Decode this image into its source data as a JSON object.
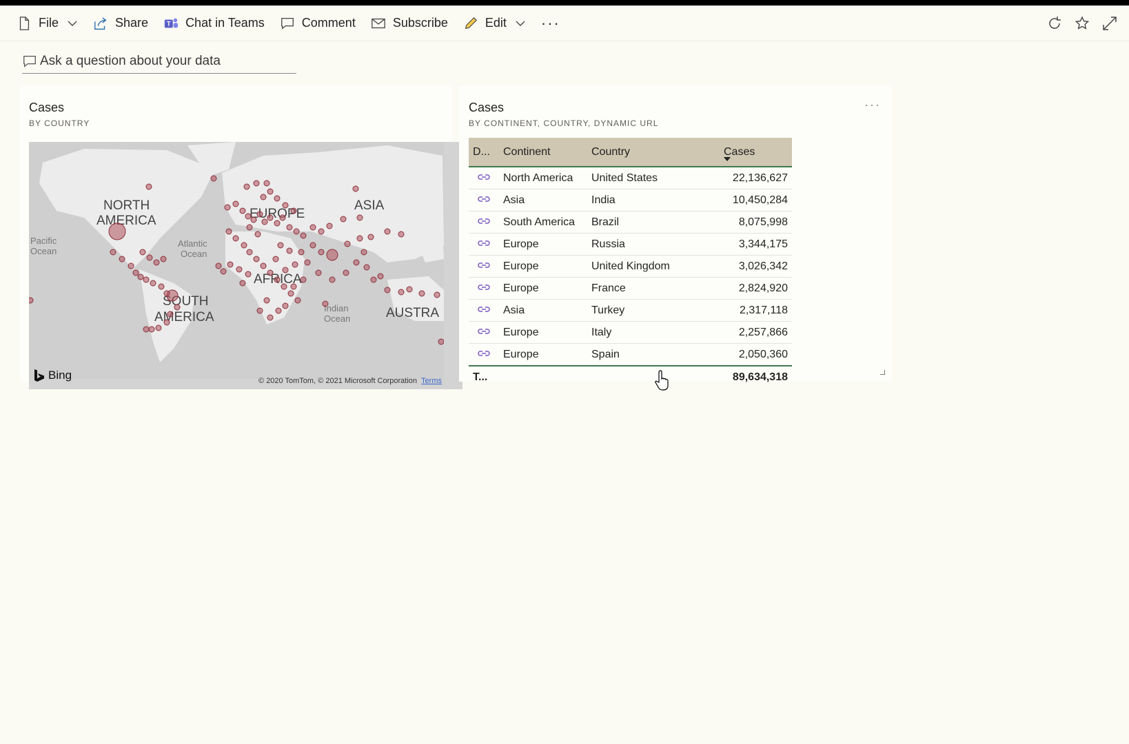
{
  "toolbar": {
    "file": "File",
    "share": "Share",
    "chat_in_teams": "Chat in Teams",
    "comment": "Comment",
    "subscribe": "Subscribe",
    "edit": "Edit",
    "more": "···"
  },
  "qa": {
    "placeholder": "Ask a question about your data"
  },
  "map_tile": {
    "title": "Cases",
    "subtitle": "BY COUNTRY",
    "labels": {
      "north_america_1": "NORTH",
      "north_america_2": "AMERICA",
      "europe": "EUROPE",
      "asia": "ASIA",
      "africa": "AFRICA",
      "south_america_1": "SOUTH",
      "south_america_2": "AMERICA",
      "australia": "AUSTRA",
      "pacific_1": "Pacific",
      "pacific_2": "Ocean",
      "atlantic_1": "Atlantic",
      "atlantic_2": "Ocean",
      "indian_1": "Indian",
      "indian_2": "Ocean"
    },
    "bing": "Bing",
    "copyright": "© 2020 TomTom, © 2021 Microsoft Corporation",
    "terms": "Terms"
  },
  "table_tile": {
    "title": "Cases",
    "subtitle": "BY CONTINENT, COUNTRY, DYNAMIC URL",
    "more": "···",
    "headers": {
      "d": "D...",
      "continent": "Continent",
      "country": "Country",
      "cases": "Cases"
    },
    "rows": [
      {
        "continent": "North America",
        "country": "United States",
        "cases": "22,136,627"
      },
      {
        "continent": "Asia",
        "country": "India",
        "cases": "10,450,284"
      },
      {
        "continent": "South America",
        "country": "Brazil",
        "cases": "8,075,998"
      },
      {
        "continent": "Europe",
        "country": "Russia",
        "cases": "3,344,175"
      },
      {
        "continent": "Europe",
        "country": "United Kingdom",
        "cases": "3,026,342"
      },
      {
        "continent": "Europe",
        "country": "France",
        "cases": "2,824,920"
      },
      {
        "continent": "Asia",
        "country": "Turkey",
        "cases": "2,317,118"
      },
      {
        "continent": "Europe",
        "country": "Italy",
        "cases": "2,257,866"
      },
      {
        "continent": "Europe",
        "country": "Spain",
        "cases": "2,050,360"
      }
    ],
    "total_label": "T...",
    "total_value": "89,634,318"
  },
  "colors": {
    "accent_green": "#3c7a4f",
    "header_tan": "#cfc7b1",
    "bubble": "#b0545e",
    "link_purple": "#7a58c2"
  }
}
